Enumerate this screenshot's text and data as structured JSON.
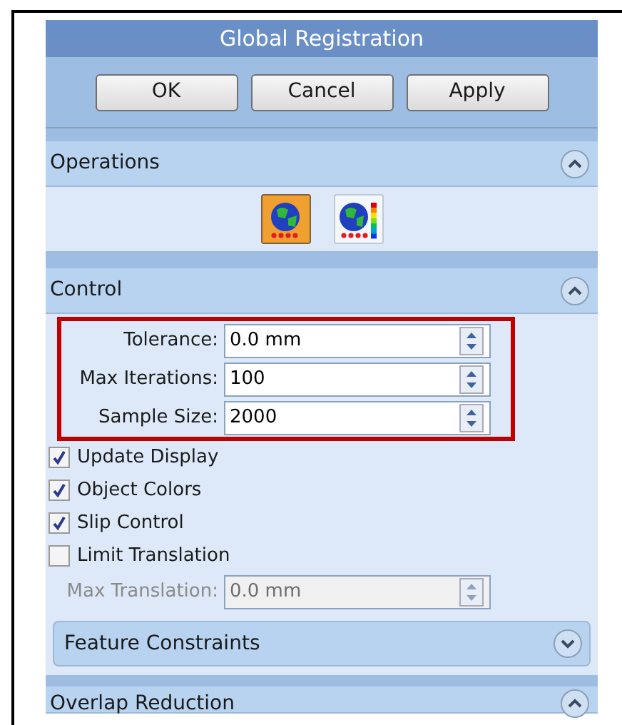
{
  "window": {
    "title": "Global Registration"
  },
  "buttons": [
    "OK",
    "Cancel",
    "Apply"
  ],
  "operations": {
    "title": "Operations",
    "expanded": true,
    "tools": [
      {
        "kind": "globe",
        "selected": true
      },
      {
        "kind": "globe-scale",
        "selected": false
      }
    ]
  },
  "control": {
    "title": "Control",
    "expanded": true,
    "fields": [
      {
        "label": "Tolerance:",
        "value": "0.0 mm",
        "disabled": false
      },
      {
        "label": "Max Iterations:",
        "value": "100",
        "disabled": false
      },
      {
        "label": "Sample Size:",
        "value": "2000",
        "disabled": false
      }
    ],
    "checkboxes": [
      {
        "label": "Update Display",
        "checked": true
      },
      {
        "label": "Object Colors",
        "checked": true
      },
      {
        "label": "Slip Control",
        "checked": true
      },
      {
        "label": "Limit Translation",
        "checked": false
      }
    ],
    "extra_fields": [
      {
        "label": "Max Translation:",
        "value": "0.0 mm",
        "disabled": true
      }
    ],
    "subsection": {
      "title": "Feature Constraints",
      "expanded": false
    }
  },
  "overlap": {
    "title": "Overlap Reduction",
    "expanded": true
  }
}
